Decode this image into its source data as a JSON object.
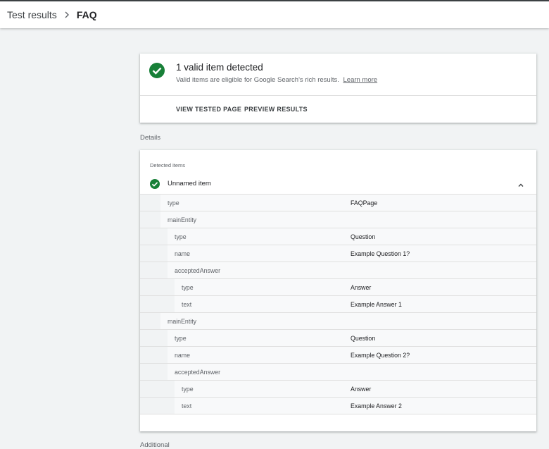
{
  "breadcrumb": {
    "root": "Test results",
    "current": "FAQ"
  },
  "summary": {
    "title": "1 valid item detected",
    "description": "Valid items are eligible for Google Search's rich results.",
    "learn_more": "Learn more",
    "actions": {
      "view_tested_page": "VIEW TESTED PAGE",
      "preview_results": "PREVIEW RESULTS"
    }
  },
  "details_label": "Details",
  "detected": {
    "label": "Detected items",
    "item_name": "Unnamed item",
    "properties": [
      {
        "key": "type",
        "value": "FAQPage",
        "depth": 1
      },
      {
        "key": "mainEntity",
        "value": "",
        "depth": 1
      },
      {
        "key": "type",
        "value": "Question",
        "depth": 2
      },
      {
        "key": "name",
        "value": "Example Question 1?",
        "depth": 2
      },
      {
        "key": "acceptedAnswer",
        "value": "",
        "depth": 2
      },
      {
        "key": "type",
        "value": "Answer",
        "depth": 3
      },
      {
        "key": "text",
        "value": "Example Answer 1",
        "depth": 3
      },
      {
        "key": "mainEntity",
        "value": "",
        "depth": 1
      },
      {
        "key": "type",
        "value": "Question",
        "depth": 2
      },
      {
        "key": "name",
        "value": "Example Question 2?",
        "depth": 2
      },
      {
        "key": "acceptedAnswer",
        "value": "",
        "depth": 2
      },
      {
        "key": "type",
        "value": "Answer",
        "depth": 3
      },
      {
        "key": "text",
        "value": "Example Answer 2",
        "depth": 3
      }
    ]
  },
  "next_section_label": "Additional",
  "icons": {
    "valid": "check-circle-icon",
    "collapse": "chevron-up-icon",
    "separator": "chevron-right-icon"
  },
  "colors": {
    "valid_green": "#188038",
    "background": "#f1f3f4",
    "card": "#ffffff"
  }
}
